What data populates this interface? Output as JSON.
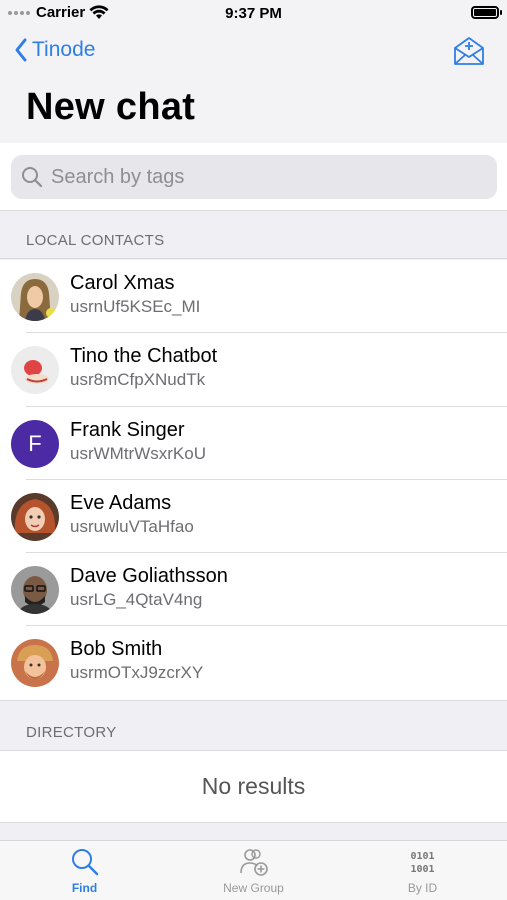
{
  "status_bar": {
    "carrier": "Carrier",
    "time": "9:37 PM"
  },
  "nav": {
    "back_label": "Tinode",
    "title": "New chat"
  },
  "search": {
    "placeholder": "Search by tags"
  },
  "sections": {
    "local_contacts": "LOCAL CONTACTS",
    "directory": "DIRECTORY"
  },
  "contacts": [
    {
      "name": "Carol Xmas",
      "id": "usrnUf5KSEc_MI"
    },
    {
      "name": "Tino the Chatbot",
      "id": "usr8mCfpXNudTk"
    },
    {
      "name": "Frank Singer",
      "id": "usrWMtrWsxrKoU",
      "initial": "F"
    },
    {
      "name": "Eve Adams",
      "id": "usruwluVTaHfao"
    },
    {
      "name": "Dave Goliathsson",
      "id": "usrLG_4QtaV4ng"
    },
    {
      "name": "Bob Smith",
      "id": "usrmOTxJ9zcrXY"
    }
  ],
  "directory": {
    "empty_text": "No results"
  },
  "tabs": [
    {
      "label": "Find",
      "icon": "search-icon",
      "active": true
    },
    {
      "label": "New Group",
      "icon": "add-group-icon",
      "active": false
    },
    {
      "label": "By ID",
      "icon": "binary-id-icon",
      "active": false,
      "icon_text": [
        "0101",
        "1001"
      ]
    }
  ],
  "colors": {
    "accent": "#2f7ee6",
    "frank_avatar": "#4b2aa3"
  }
}
